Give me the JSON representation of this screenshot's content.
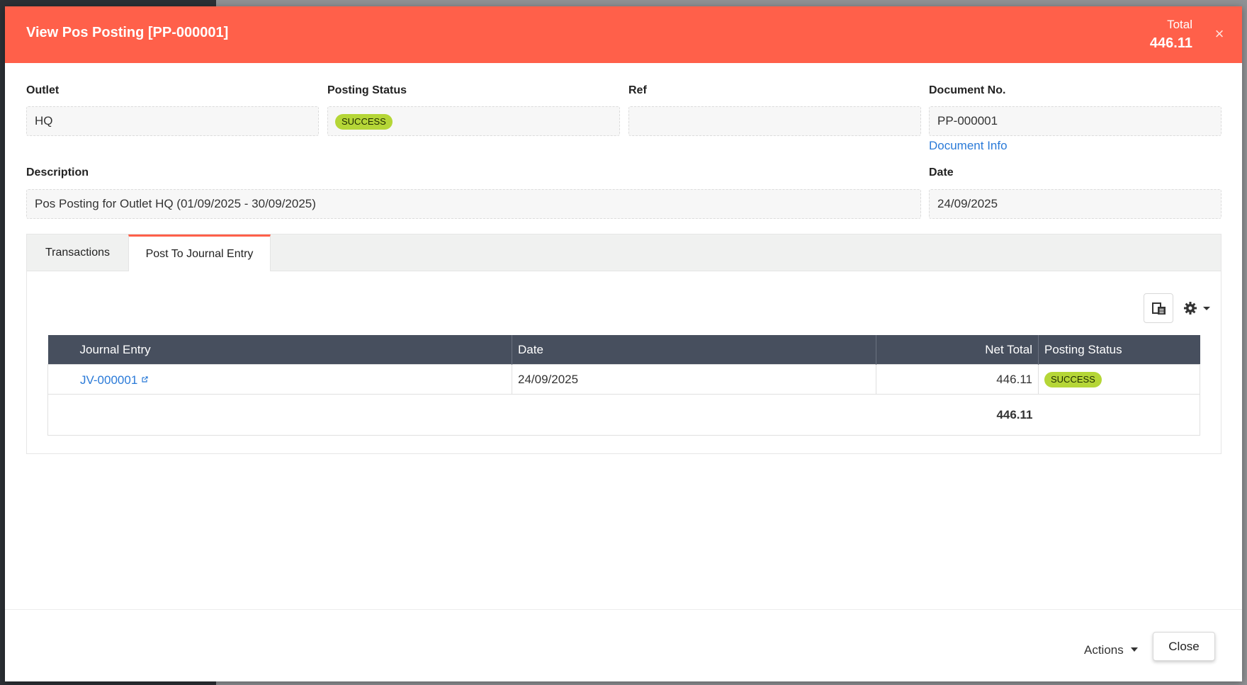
{
  "header": {
    "title": "View Pos Posting [PP-000001]",
    "total_label": "Total",
    "total_value": "446.11",
    "close_symbol": "×",
    "color": "#ff604a"
  },
  "fields": {
    "outlet": {
      "label": "Outlet",
      "value": "HQ"
    },
    "posting_status": {
      "label": "Posting Status",
      "value": "SUCCESS"
    },
    "ref": {
      "label": "Ref",
      "value": ""
    },
    "document_no": {
      "label": "Document No.",
      "value": "PP-000001",
      "link": "Document Info"
    },
    "description": {
      "label": "Description",
      "value": "Pos Posting for Outlet HQ (01/09/2025 - 30/09/2025)"
    },
    "date": {
      "label": "Date",
      "value": "24/09/2025"
    }
  },
  "tabs": [
    {
      "label": "Transactions",
      "active": false
    },
    {
      "label": "Post To Journal Entry",
      "active": true
    }
  ],
  "toolbar": {
    "layout_icon": "column-layout-icon",
    "settings_icon": "gear-icon"
  },
  "table": {
    "columns": [
      "Journal Entry",
      "Date",
      "Net Total",
      "Posting Status"
    ],
    "rows": [
      {
        "journal_entry": "JV-000001",
        "date": "24/09/2025",
        "net_total": "446.11",
        "posting_status": "SUCCESS"
      }
    ],
    "footer_total": "446.11"
  },
  "footer": {
    "actions_label": "Actions",
    "close_label": "Close"
  },
  "colors": {
    "success_badge": "#b5d637",
    "table_header": "#474f5e",
    "link": "#2a7ad8"
  }
}
